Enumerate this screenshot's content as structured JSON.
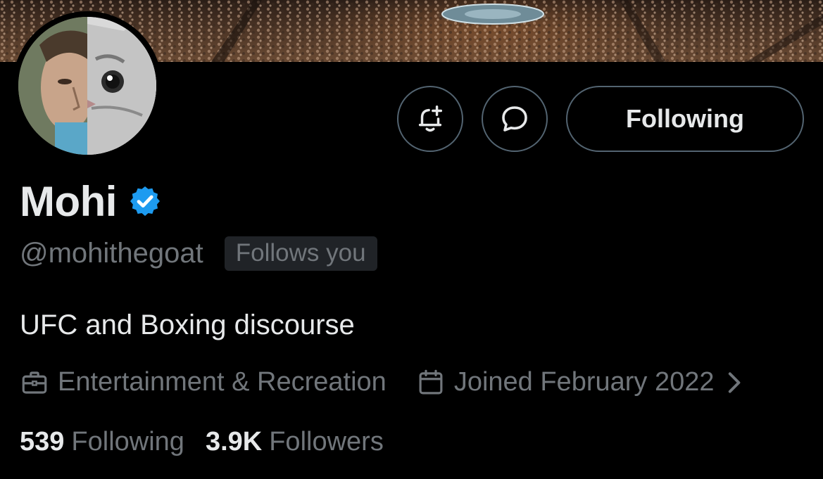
{
  "profile": {
    "display_name": "Mohi",
    "handle": "@mohithegoat",
    "follows_you_badge": "Follows you",
    "bio": "UFC and Boxing discourse",
    "category": "Entertainment & Recreation",
    "joined": "Joined February 2022",
    "verified": true
  },
  "actions": {
    "following_label": "Following"
  },
  "stats": {
    "following_count": "539",
    "following_label": "Following",
    "followers_count": "3.9K",
    "followers_label": "Followers"
  },
  "icons": {
    "notify": "bell-plus-icon",
    "message": "message-bubble-icon",
    "verified": "verified-badge-icon",
    "category": "briefcase-icon",
    "joined": "calendar-icon",
    "chevron": "chevron-right-icon"
  },
  "colors": {
    "background": "#000000",
    "text_primary": "#e7e9ea",
    "text_secondary": "#71767b",
    "border": "#536471",
    "verified_blue": "#1d9bf0",
    "badge_bg": "#202327"
  }
}
